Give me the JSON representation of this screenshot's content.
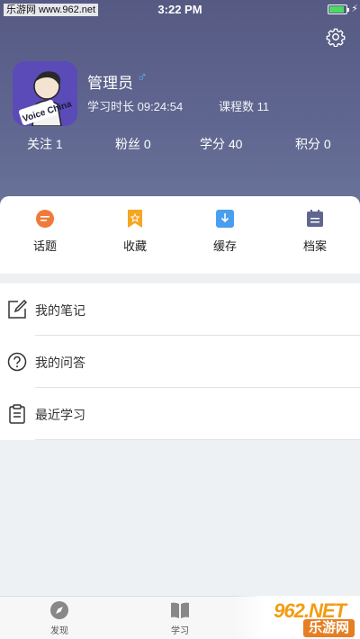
{
  "status_bar": {
    "watermark": "乐游网 www.962.net",
    "time": "3:22 PM"
  },
  "profile": {
    "name": "管理员",
    "gender_symbol": "♂",
    "study_time": "学习时长 09:24:54",
    "course_count": "课程数 11",
    "avatar_text": "Voice China"
  },
  "stats": [
    {
      "label": "关注 1"
    },
    {
      "label": "粉丝 0"
    },
    {
      "label": "学分 40"
    },
    {
      "label": "积分 0"
    }
  ],
  "quick_actions": [
    {
      "label": "话题",
      "icon": "topic-icon",
      "color": "#f07a3a"
    },
    {
      "label": "收藏",
      "icon": "favorite-icon",
      "color": "#f5a623"
    },
    {
      "label": "缓存",
      "icon": "download-icon",
      "color": "#4a9ef0"
    },
    {
      "label": "档案",
      "icon": "archive-icon",
      "color": "#5f6690"
    }
  ],
  "menu": [
    {
      "label": "我的笔记",
      "icon": "edit-icon"
    },
    {
      "label": "我的问答",
      "icon": "question-icon"
    },
    {
      "label": "最近学习",
      "icon": "clipboard-icon"
    }
  ],
  "tabbar": [
    {
      "label": "发现",
      "icon": "compass-icon"
    },
    {
      "label": "学习",
      "icon": "book-icon"
    }
  ],
  "watermark_bottom": {
    "logo": "962.NET",
    "sub": "乐游网"
  }
}
